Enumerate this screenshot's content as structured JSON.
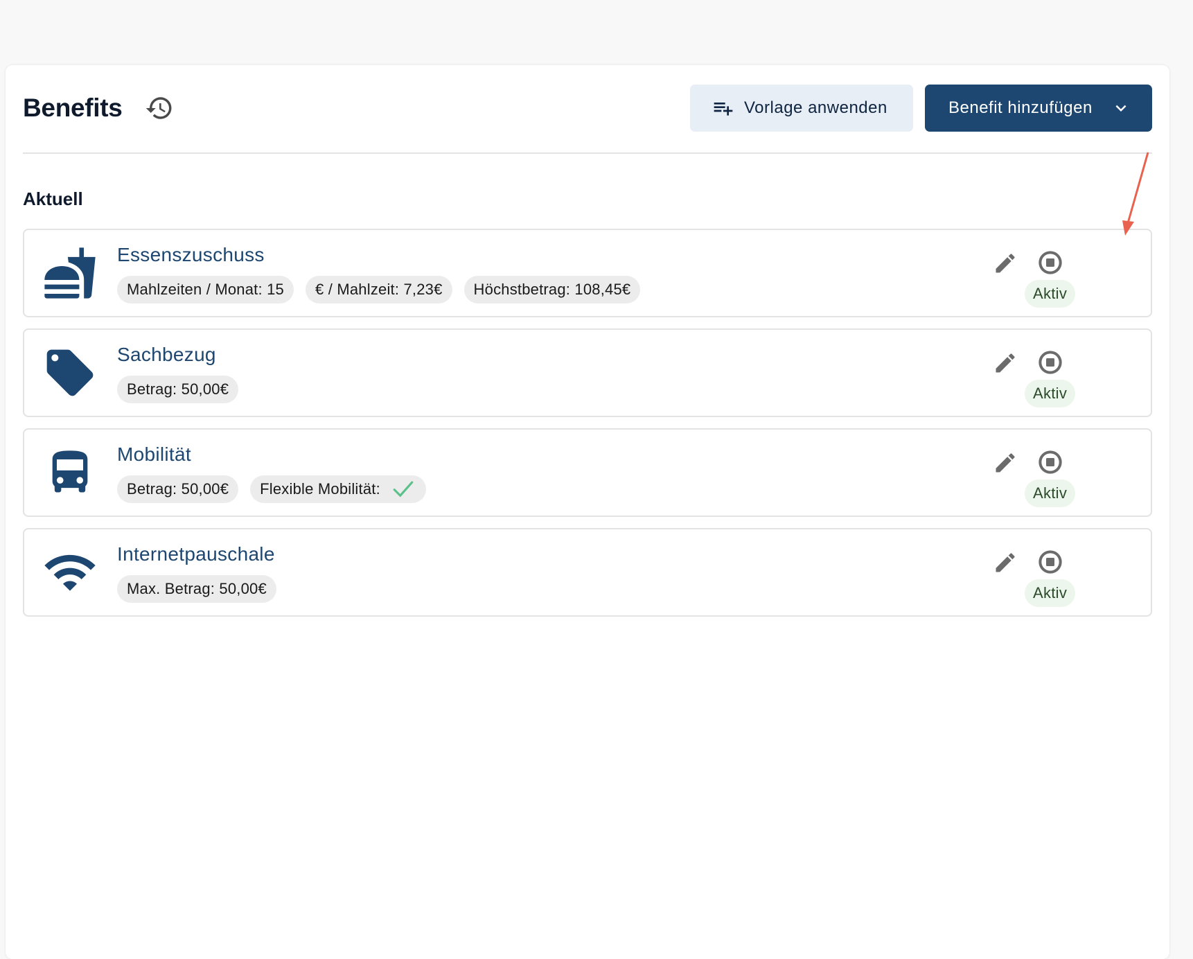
{
  "header": {
    "title": "Benefits",
    "history_icon": "history-icon",
    "template_button_label": "Vorlage anwenden",
    "add_button_label": "Benefit hinzufügen"
  },
  "section": {
    "title": "Aktuell"
  },
  "benefits": [
    {
      "name": "Essenszuschuss",
      "icon": "fastfood-icon",
      "chips": [
        "Mahlzeiten / Monat: 15",
        "€ / Mahlzeit: 7,23€",
        "Höchstbetrag: 108,45€"
      ],
      "status": "Aktiv"
    },
    {
      "name": "Sachbezug",
      "icon": "tag-icon",
      "chips": [
        "Betrag: 50,00€"
      ],
      "status": "Aktiv"
    },
    {
      "name": "Mobilität",
      "icon": "bus-icon",
      "chips": [
        "Betrag: 50,00€",
        "Flexible Mobilität:"
      ],
      "status": "Aktiv"
    },
    {
      "name": "Internetpauschale",
      "icon": "wifi-icon",
      "chips": [
        "Max. Betrag: 50,00€"
      ],
      "status": "Aktiv"
    }
  ],
  "colors": {
    "primary": "#1d4670",
    "template_button_bg": "#e8eef6",
    "status_bg": "#edf6ec",
    "check_green": "#5cc08a",
    "annotation_arrow": "#e8624f"
  }
}
